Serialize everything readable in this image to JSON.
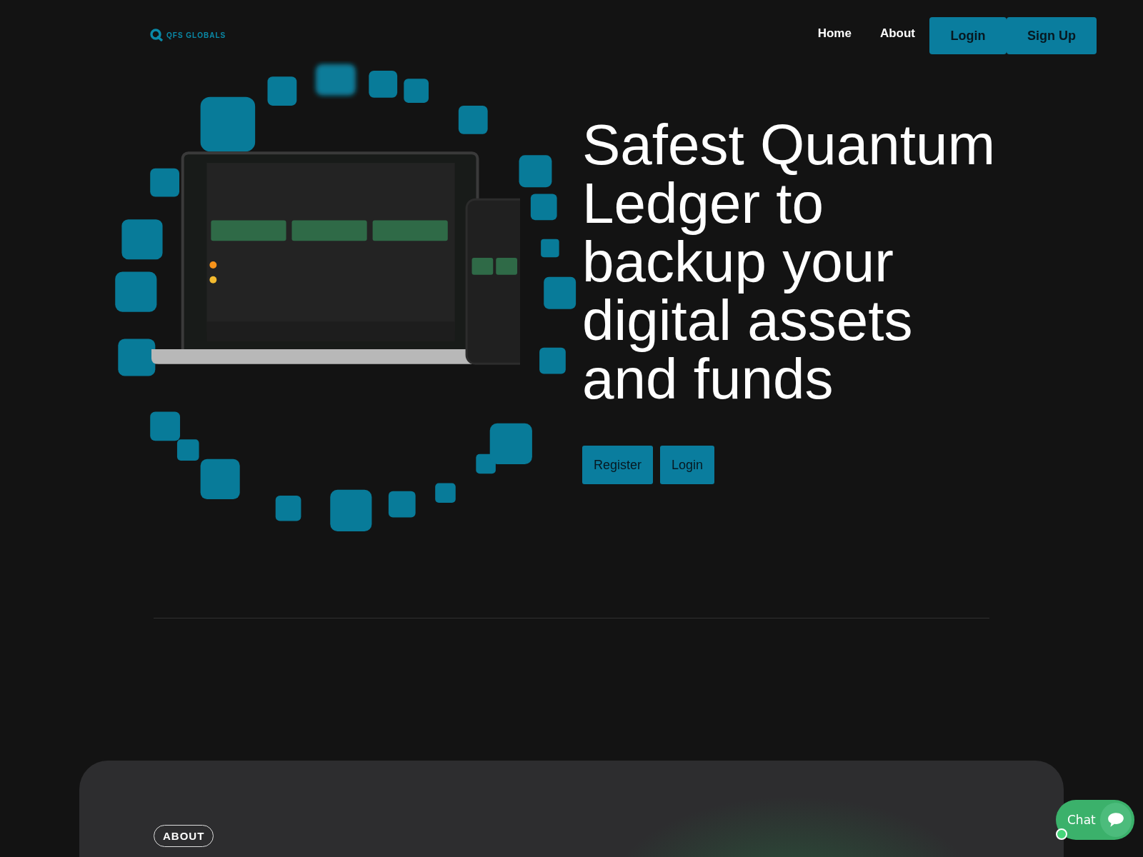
{
  "header": {
    "logo_text": "QFS GLOBALS",
    "nav": [
      {
        "label": "Home",
        "kind": "link"
      },
      {
        "label": "About",
        "kind": "link"
      },
      {
        "label": "Login",
        "kind": "button"
      },
      {
        "label": "Sign Up",
        "kind": "button"
      }
    ]
  },
  "hero": {
    "headline": "Safest Quantum Ledger to backup your digital assets and funds",
    "buttons": [
      "Register",
      "Login"
    ]
  },
  "about": {
    "badge": "ABOUT"
  },
  "chat": {
    "label": "Chat"
  }
}
